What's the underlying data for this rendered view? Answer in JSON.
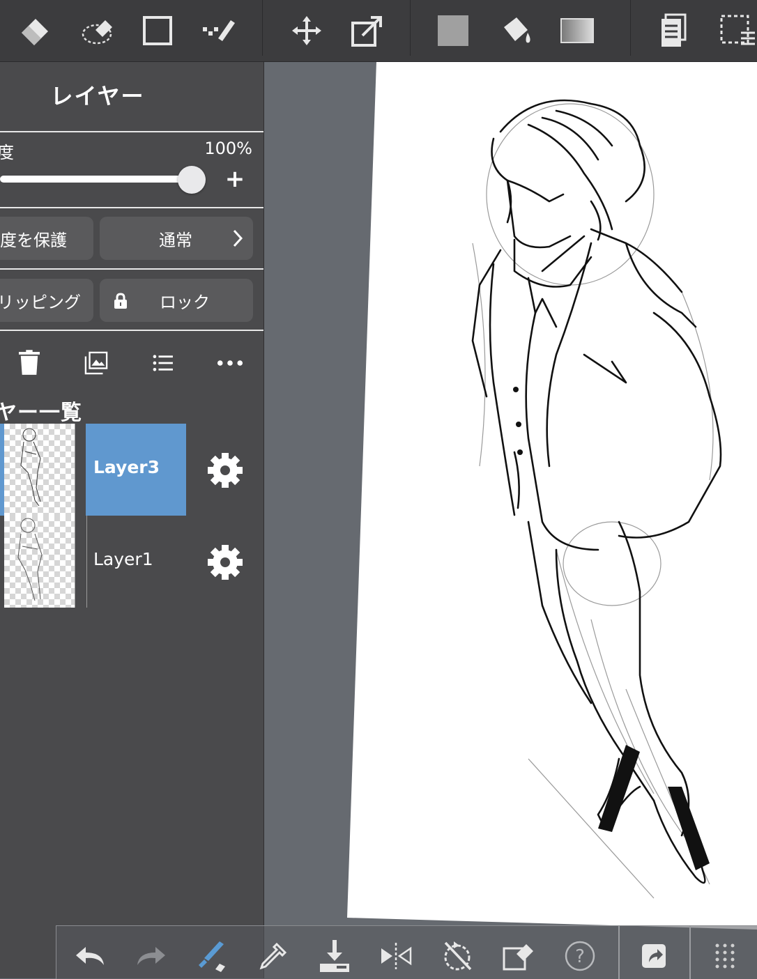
{
  "panel": {
    "title": "レイヤー",
    "opacity_label": "度",
    "opacity_value": "100%",
    "opacity_fraction": 1.0,
    "protect_alpha_label": "度を保護",
    "blend_mode_label": "通常",
    "clipping_label": "リッピング",
    "lock_label": "ロック",
    "list_title": "ヤー一覧",
    "layers": [
      {
        "name": "Layer3",
        "selected": true
      },
      {
        "name": "Layer1",
        "selected": false
      }
    ]
  },
  "colors": {
    "toolbar_bg": "#3c3c3e",
    "panel_bg": "#4a4a4c",
    "selected_layer": "#6098cf",
    "canvas_bg": "#666a70",
    "paper": "#ffffff"
  },
  "top_toolbar_icons": [
    "eraser-icon",
    "lasso-eraser-icon",
    "rectangle-select-icon",
    "magic-wand-icon",
    "move-icon",
    "transform-icon",
    "fill-color-icon",
    "bucket-icon",
    "gradient-icon",
    "layers-icon",
    "selection-menu-icon"
  ],
  "bottom_toolbar_icons": [
    "undo-icon",
    "redo-icon",
    "brush-color-icon",
    "eyedropper-icon",
    "save-icon",
    "flip-icon",
    "rotate-reset-icon",
    "transform-select-icon",
    "help-icon",
    "share-icon",
    "grid-menu-icon"
  ],
  "help_glyph": "?"
}
